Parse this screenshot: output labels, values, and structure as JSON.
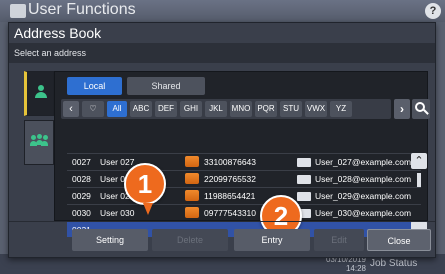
{
  "background": {
    "title": "User Functions",
    "help": "?",
    "date": "03/10/2019",
    "time": "14:28",
    "job_status": "Job Status"
  },
  "dialog": {
    "title": "Address Book",
    "subtitle": "Select an address"
  },
  "toggles": {
    "local": "Local",
    "shared": "Shared"
  },
  "letters": [
    "All",
    "ABC",
    "DEF",
    "GHI",
    "JKL",
    "MNO",
    "PQR",
    "STU",
    "VWX",
    "YZ"
  ],
  "active_letter": "All",
  "rows": [
    {
      "id": "0027",
      "name": "User 027",
      "fax": "33100876643",
      "email": "User_027@example.com"
    },
    {
      "id": "0028",
      "name": "User 028",
      "fax": "22099765532",
      "email": "User_028@example.com"
    },
    {
      "id": "0029",
      "name": "User 029",
      "fax": "11988654421",
      "email": "User_029@example.com"
    },
    {
      "id": "0030",
      "name": "User 030",
      "fax": "09777543310",
      "email": "User_030@example.com"
    },
    {
      "id": "0031",
      "name": "",
      "fax": "",
      "email": ""
    }
  ],
  "selected_row": "0031",
  "callouts": [
    "1",
    "2"
  ],
  "footer": {
    "setting": "Setting",
    "delete": "Delete",
    "entry": "Entry",
    "edit": "Edit",
    "close": "Close"
  },
  "colors": {
    "accent": "#2e6fd1",
    "callout": "#ee6a1e",
    "selected_row": "#3152a6"
  }
}
